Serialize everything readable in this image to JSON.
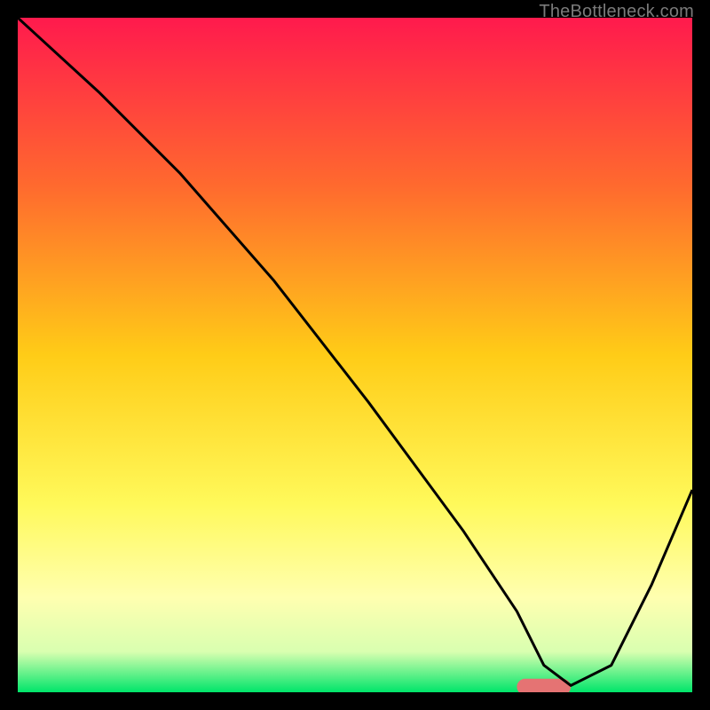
{
  "watermark": {
    "text": "TheBottleneck.com"
  },
  "chart_data": {
    "type": "line",
    "title": "",
    "xlabel": "",
    "ylabel": "",
    "xlim": [
      0,
      100
    ],
    "ylim": [
      0,
      100
    ],
    "grid": false,
    "legend": false,
    "background": {
      "kind": "vertical-gradient",
      "stops": [
        {
          "pos": 0,
          "color": "#ff1a4d"
        },
        {
          "pos": 25,
          "color": "#ff6a2e"
        },
        {
          "pos": 50,
          "color": "#ffcc17"
        },
        {
          "pos": 72,
          "color": "#fff95a"
        },
        {
          "pos": 86,
          "color": "#ffffb0"
        },
        {
          "pos": 94,
          "color": "#d9ffb0"
        },
        {
          "pos": 100,
          "color": "#00e56a"
        }
      ]
    },
    "series": [
      {
        "name": "bottleneck-curve",
        "color": "#000000",
        "x": [
          0,
          12,
          24,
          38,
          52,
          66,
          74,
          78,
          82,
          88,
          94,
          100
        ],
        "y": [
          100,
          89,
          77,
          61,
          43,
          24,
          12,
          4,
          1,
          4,
          16,
          30
        ]
      }
    ],
    "marker": {
      "name": "optimal-range",
      "shape": "pill",
      "color": "#e57373",
      "x_start": 74,
      "x_end": 82,
      "y": 0.8,
      "height": 2.4
    }
  }
}
